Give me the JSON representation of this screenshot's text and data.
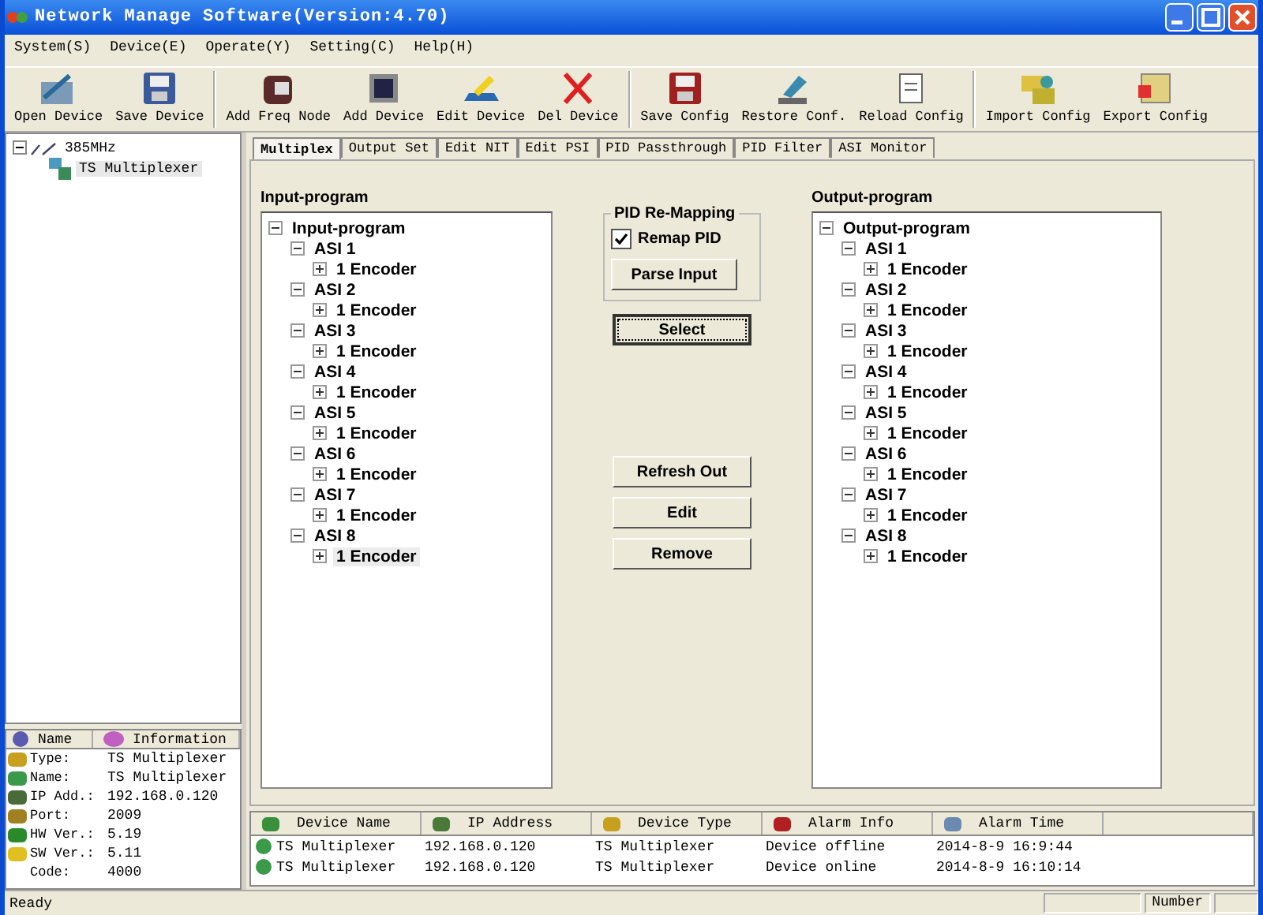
{
  "window": {
    "title": "Network Manage Software(Version:4.70)"
  },
  "menu": [
    "System(S)",
    "Device(E)",
    "Operate(Y)",
    "Setting(C)",
    "Help(H)"
  ],
  "toolbar": [
    {
      "label": "Open Device",
      "kind": "open"
    },
    {
      "label": "Save Device",
      "kind": "save"
    },
    {
      "label": "Add Freq Node",
      "kind": "node",
      "group_start": true
    },
    {
      "label": "Add Device",
      "kind": "device"
    },
    {
      "label": "Edit Device",
      "kind": "edit"
    },
    {
      "label": "Del Device",
      "kind": "delete"
    },
    {
      "label": "Save Config",
      "kind": "save-config",
      "group_start": true
    },
    {
      "label": "Restore Conf.",
      "kind": "restore"
    },
    {
      "label": "Reload Config",
      "kind": "reload"
    },
    {
      "label": "Import Config",
      "kind": "import",
      "group_start": true
    },
    {
      "label": "Export Config",
      "kind": "export"
    }
  ],
  "device_tree": {
    "label": "385MHz",
    "expanded": true,
    "children": [
      {
        "label": "TS Multiplexer",
        "selected": true
      }
    ]
  },
  "info_table": {
    "columns": [
      "Name",
      "Information"
    ],
    "rows": [
      {
        "name": "Type:",
        "value": "TS Multiplexer",
        "kind": "type"
      },
      {
        "name": "Name:",
        "value": "TS Multiplexer",
        "kind": "name"
      },
      {
        "name": "IP Add.:",
        "value": "192.168.0.120",
        "kind": "ip"
      },
      {
        "name": "Port:",
        "value": "2009",
        "kind": "port"
      },
      {
        "name": "HW Ver.:",
        "value": "5.19",
        "kind": "hw"
      },
      {
        "name": "SW Ver.:",
        "value": "5.11",
        "kind": "sw"
      },
      {
        "name": "Code:",
        "value": "4000",
        "kind": "code"
      }
    ]
  },
  "tabs": [
    {
      "label": "Multiplex",
      "selected": true
    },
    {
      "label": "Output Set",
      "selected": false
    },
    {
      "label": "Edit NIT",
      "selected": false
    },
    {
      "label": "Edit PSI",
      "selected": false
    },
    {
      "label": "PID Passthrough",
      "selected": false
    },
    {
      "label": "PID Filter",
      "selected": false
    },
    {
      "label": "ASI Monitor",
      "selected": false
    }
  ],
  "input_program": {
    "heading": "Input-program",
    "tree": {
      "label": "Input-program",
      "expanded": true,
      "children": [
        {
          "label": "ASI 1",
          "expanded": true,
          "children": [
            {
              "label": "1 Encoder",
              "expanded": false
            }
          ]
        },
        {
          "label": "ASI 2",
          "expanded": true,
          "children": [
            {
              "label": "1 Encoder",
              "expanded": false
            }
          ]
        },
        {
          "label": "ASI 3",
          "expanded": true,
          "children": [
            {
              "label": "1 Encoder",
              "expanded": false
            }
          ]
        },
        {
          "label": "ASI 4",
          "expanded": true,
          "children": [
            {
              "label": "1 Encoder",
              "expanded": false
            }
          ]
        },
        {
          "label": "ASI 5",
          "expanded": true,
          "children": [
            {
              "label": "1 Encoder",
              "expanded": false
            }
          ]
        },
        {
          "label": "ASI 6",
          "expanded": true,
          "children": [
            {
              "label": "1 Encoder",
              "expanded": false
            }
          ]
        },
        {
          "label": "ASI 7",
          "expanded": true,
          "children": [
            {
              "label": "1 Encoder",
              "expanded": false
            }
          ]
        },
        {
          "label": "ASI 8",
          "expanded": true,
          "children": [
            {
              "label": "1 Encoder",
              "expanded": false,
              "selected": true
            }
          ]
        }
      ]
    }
  },
  "pid_remapping": {
    "title": "PID Re-Mapping",
    "remap_pid": {
      "label": "Remap PID",
      "checked": true
    },
    "parse_button": "Parse Input"
  },
  "select_button": "Select",
  "action_buttons": [
    "Refresh Out",
    "Edit",
    "Remove"
  ],
  "output_program": {
    "heading": "Output-program",
    "tree": {
      "label": "Output-program",
      "expanded": true,
      "children": [
        {
          "label": "ASI 1",
          "expanded": true,
          "children": [
            {
              "label": "1 Encoder",
              "expanded": false
            }
          ]
        },
        {
          "label": "ASI 2",
          "expanded": true,
          "children": [
            {
              "label": "1 Encoder",
              "expanded": false
            }
          ]
        },
        {
          "label": "ASI 3",
          "expanded": true,
          "children": [
            {
              "label": "1 Encoder",
              "expanded": false
            }
          ]
        },
        {
          "label": "ASI 4",
          "expanded": true,
          "children": [
            {
              "label": "1 Encoder",
              "expanded": false
            }
          ]
        },
        {
          "label": "ASI 5",
          "expanded": true,
          "children": [
            {
              "label": "1 Encoder",
              "expanded": false
            }
          ]
        },
        {
          "label": "ASI 6",
          "expanded": true,
          "children": [
            {
              "label": "1 Encoder",
              "expanded": false
            }
          ]
        },
        {
          "label": "ASI 7",
          "expanded": true,
          "children": [
            {
              "label": "1 Encoder",
              "expanded": false
            }
          ]
        },
        {
          "label": "ASI 8",
          "expanded": true,
          "children": [
            {
              "label": "1 Encoder",
              "expanded": false
            }
          ]
        }
      ]
    }
  },
  "alarm_table": {
    "columns": [
      "Device Name",
      "IP Address",
      "Device Type",
      "Alarm Info",
      "Alarm Time"
    ],
    "rows": [
      [
        "TS Multiplexer",
        "192.168.0.120",
        "TS Multiplexer",
        "Device offline",
        "2014-8-9 16:9:44"
      ],
      [
        "TS Multiplexer",
        "192.168.0.120",
        "TS Multiplexer",
        "Device online",
        "2014-8-9 16:10:14"
      ]
    ]
  },
  "status_bar": {
    "message": "Ready",
    "number_label": "Number"
  }
}
